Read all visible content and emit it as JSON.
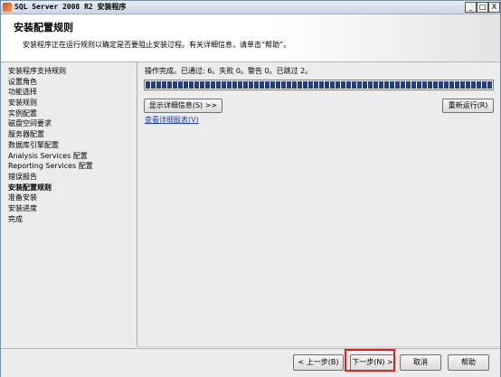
{
  "window": {
    "title": "SQL Server 2008 R2 安装程序",
    "controls": {
      "minimize": "_",
      "maximize": "□",
      "close": "X"
    }
  },
  "header": {
    "title": "安装配置规则",
    "description": "安装程序正在运行规则以确定是否要阻止安装过程。有关详细信息，请单击“帮助”。"
  },
  "sidebar": {
    "items": [
      {
        "label": "安装程序支持规则"
      },
      {
        "label": "设置角色"
      },
      {
        "label": "功能选择"
      },
      {
        "label": "安装规则"
      },
      {
        "label": "实例配置"
      },
      {
        "label": "磁盘空间要求"
      },
      {
        "label": "服务器配置"
      },
      {
        "label": "数据库引擎配置"
      },
      {
        "label": "Analysis Services 配置"
      },
      {
        "label": "Reporting Services 配置"
      },
      {
        "label": "错误报告"
      },
      {
        "label": "安装配置规则"
      },
      {
        "label": "准备安装"
      },
      {
        "label": "安装进度"
      },
      {
        "label": "完成"
      }
    ],
    "current_index": 11
  },
  "main": {
    "status_text": "操作完成。已通过: 6。失败 0。警告 0。已跳过 2。",
    "progress": 1.0,
    "show_details_button": "显示详细信息(S) >>",
    "rerun_button": "重新运行(R)",
    "report_link": "查看详细报表(V)"
  },
  "footer": {
    "back_button": "< 上一步(B)",
    "next_button": "下一步(N) >",
    "cancel_button": "取消",
    "help_button": "帮助"
  },
  "colors": {
    "progress_fill": "#1c3f94",
    "highlight": "#e0201c",
    "link": "#1a3fbf"
  }
}
